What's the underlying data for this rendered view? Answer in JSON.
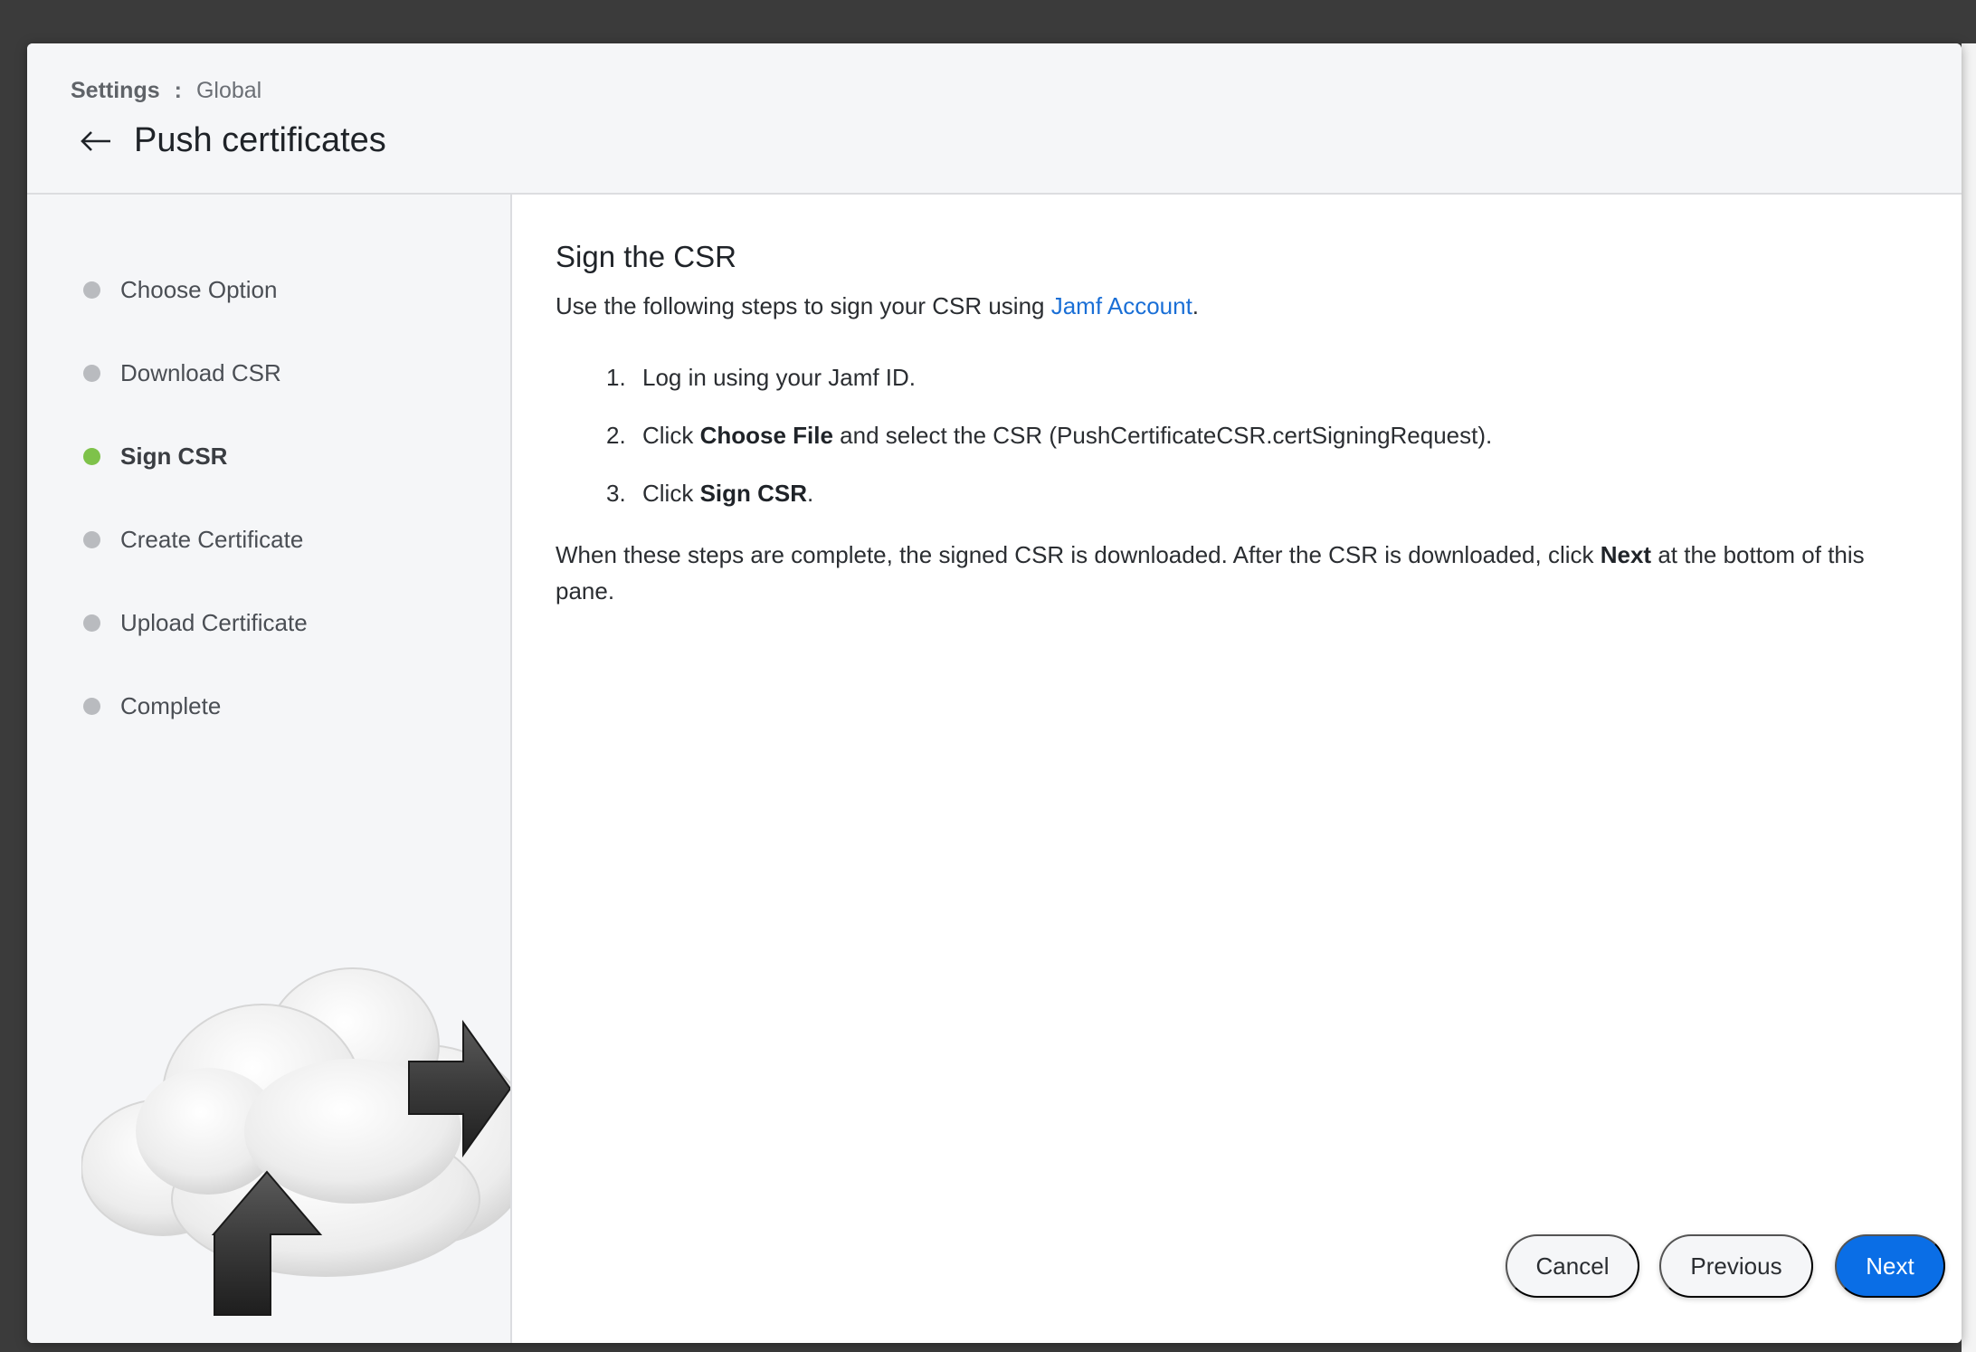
{
  "header": {
    "breadcrumb_parent": "Settings",
    "breadcrumb_separator": ":",
    "breadcrumb_current": "Global",
    "title": "Push certificates"
  },
  "sidebar": {
    "steps": [
      {
        "label": "Choose Option",
        "active": false
      },
      {
        "label": "Download CSR",
        "active": false
      },
      {
        "label": "Sign CSR",
        "active": true
      },
      {
        "label": "Create Certificate",
        "active": false
      },
      {
        "label": "Upload Certificate",
        "active": false
      },
      {
        "label": "Complete",
        "active": false
      }
    ]
  },
  "content": {
    "title": "Sign the CSR",
    "intro_prefix": "Use the following steps to sign your CSR using ",
    "intro_link": "Jamf Account",
    "intro_suffix": ".",
    "steps": [
      {
        "num": "1.",
        "pre": "Log in using your Jamf ID.",
        "bold": "",
        "post": ""
      },
      {
        "num": "2.",
        "pre": "Click ",
        "bold": "Choose File",
        "post": " and select the CSR (PushCertificateCSR.certSigningRequest)."
      },
      {
        "num": "3.",
        "pre": "Click ",
        "bold": "Sign CSR",
        "post": "."
      }
    ],
    "outro_prefix": "When these steps are complete, the signed CSR is downloaded. After the CSR is downloaded, click ",
    "outro_bold": "Next",
    "outro_suffix": " at the bottom of this pane."
  },
  "footer": {
    "cancel_label": "Cancel",
    "previous_label": "Previous",
    "next_label": "Next"
  },
  "colors": {
    "accent": "#0a6ee6",
    "link": "#1a6fd6",
    "active_step": "#7ec24a",
    "inactive_step": "#b9bbbf"
  },
  "icons": {
    "back": "arrow-left-icon",
    "illustration": "cloud-upload-download-illustration"
  }
}
